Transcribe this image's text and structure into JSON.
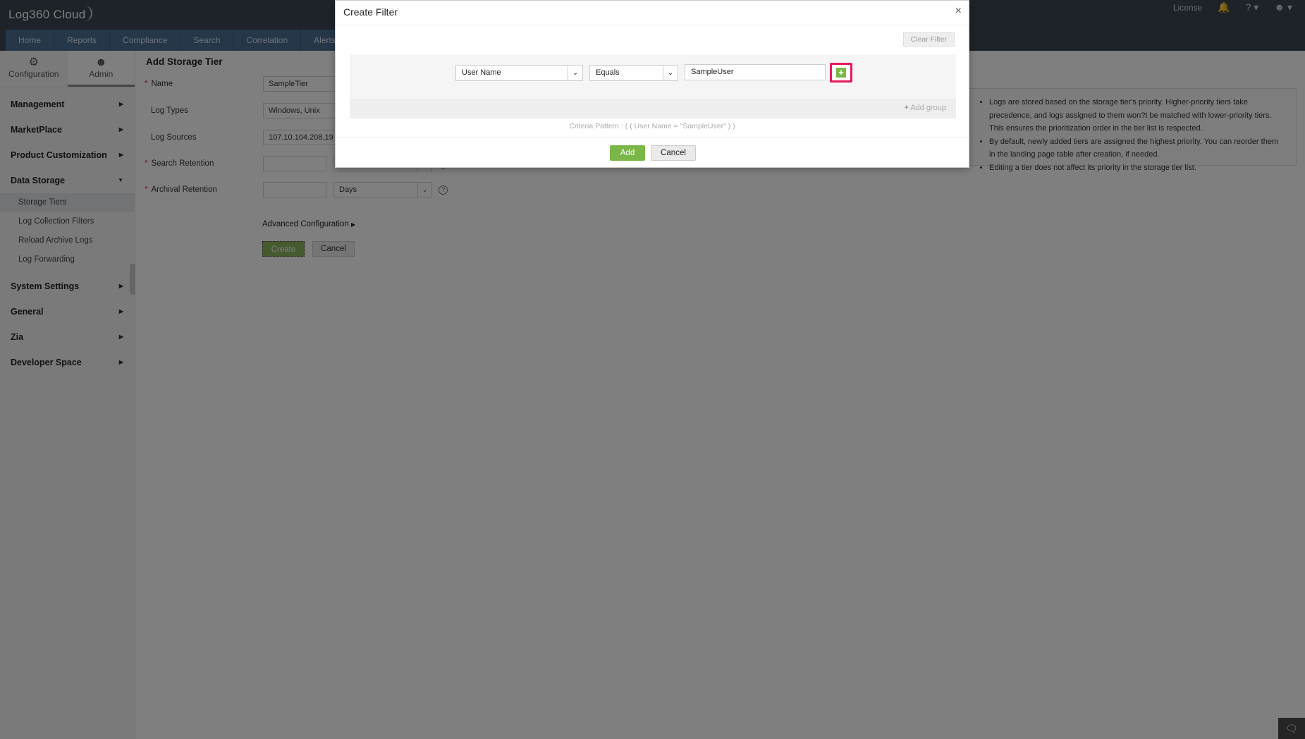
{
  "app": {
    "brand": "Log360 Cloud"
  },
  "topbar": {
    "license": "License",
    "bell": "bell-icon",
    "help": "?",
    "user": "user-icon"
  },
  "nav": {
    "tabs": [
      "Home",
      "Reports",
      "Compliance",
      "Search",
      "Correlation",
      "Alerts"
    ]
  },
  "sidebar": {
    "toggle": {
      "configuration": "Configuration",
      "admin": "Admin"
    },
    "sections": [
      "Management",
      "MarketPlace",
      "Product Customization",
      "Data Storage"
    ],
    "data_storage_items": [
      "Storage Tiers",
      "Log Collection Filters",
      "Reload Archive Logs",
      "Log Forwarding"
    ],
    "sections_after": [
      "System Settings",
      "General",
      "Zia",
      "Developer Space"
    ]
  },
  "form": {
    "title": "Add Storage Tier",
    "name_label": "Name",
    "name_value": "SampleTier",
    "log_types_label": "Log Types",
    "log_types_value": "Windows, Unix",
    "log_sources_label": "Log Sources",
    "log_sources_value": "107.10.104.208,19",
    "search_retention_label": "Search Retention",
    "archival_retention_label": "Archival Retention",
    "days": "Days",
    "advanced": "Advanced Configuration",
    "create": "Create",
    "cancel": "Cancel"
  },
  "note": {
    "label": "e",
    "items": [
      "Logs are stored based on the storage tier's priority. Higher-priority tiers take precedence, and logs assigned to them won?t be matched with lower-priority tiers. This ensures the prioritization order in the tier list is respected.",
      "By default, newly added tiers are assigned the highest priority. You can reorder them in the landing page table after creation, if needed.",
      "Editing a tier does not affect its priority in the storage tier list."
    ]
  },
  "modal": {
    "title": "Create Filter",
    "close": "×",
    "clear_filter": "Clear Filter",
    "field": "User Name",
    "operator": "Equals",
    "value": "SampleUser",
    "add_group": "Add group",
    "criteria_pattern": "Criteria Pattern : ( ( User Name = \"SampleUser\" ) )",
    "add": "Add",
    "cancel": "Cancel"
  },
  "colors": {
    "accent_green": "#7ab648",
    "highlight": "#e6195a",
    "nav_blue": "#4a6f93",
    "topbar": "#3a4652"
  }
}
